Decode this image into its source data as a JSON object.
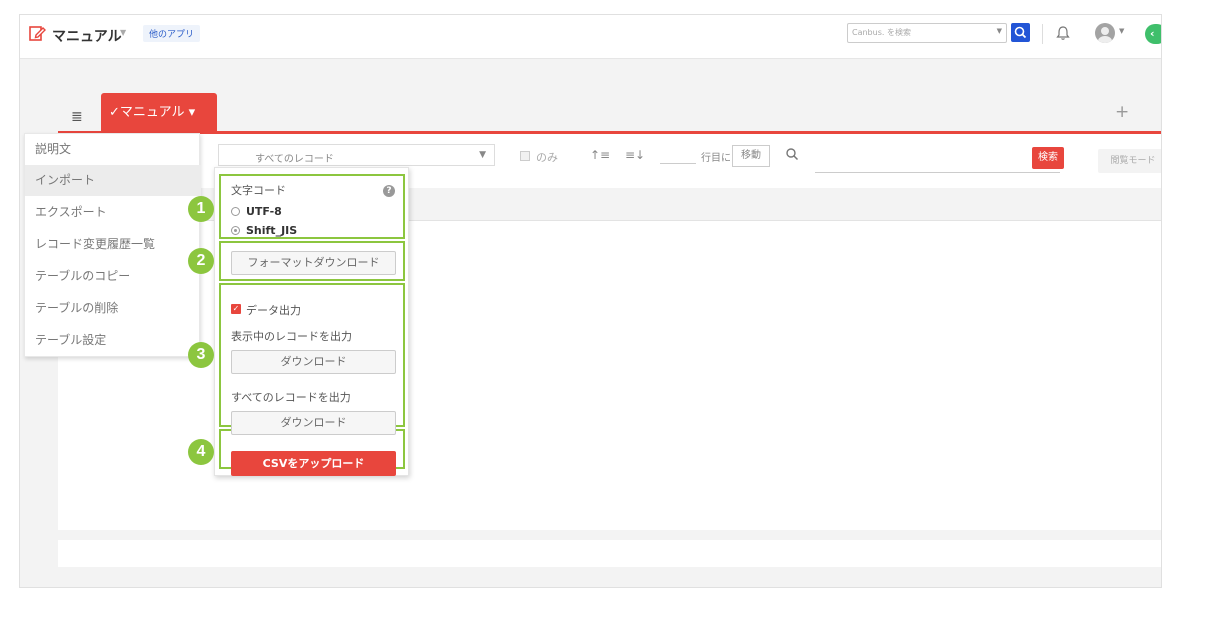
{
  "header": {
    "app_title": "マニュアル",
    "other_apps": "他のアプリ",
    "search_placeholder": "Canbus. を検索"
  },
  "tabs": {
    "active_label": "✓マニュアル ▾",
    "add": "+"
  },
  "toolbar": {
    "view_select": "すべてのレコード",
    "only_label": "のみ",
    "row_label": "行目に",
    "move_button": "移動",
    "search_button": "検索",
    "browse_mode": "閲覧モード"
  },
  "side_menu": {
    "items": [
      {
        "label": "説明文"
      },
      {
        "label": "インポート"
      },
      {
        "label": "エクスポート"
      },
      {
        "label": "レコード変更履歴一覧"
      },
      {
        "label": "テーブルのコピー"
      },
      {
        "label": "テーブルの削除"
      },
      {
        "label": "テーブル設定"
      }
    ],
    "highlighted_index": 1
  },
  "import_export": {
    "charcode_title": "文字コード",
    "options": [
      "UTF-8",
      "Shift_JIS"
    ],
    "selected_option": "Shift_JIS",
    "format_download": "フォーマットダウンロード",
    "data_output": "データ出力",
    "data_output_checked": true,
    "displayed_records_label": "表示中のレコードを出力",
    "download_label": "ダウンロード",
    "all_records_label": "すべてのレコードを出力",
    "csv_upload": "CSVをアップロード"
  },
  "badges": [
    "1",
    "2",
    "3",
    "4"
  ],
  "colors": {
    "accent_red": "#e8463d",
    "annotation_green": "#8cc63f",
    "search_blue": "#2255d6",
    "status_green": "#3fbf6b"
  },
  "icons": {
    "app": "edit-document-icon",
    "search": "search-icon",
    "bell": "bell-icon",
    "avatar": "user-avatar-icon",
    "menu": "hamburger-icon",
    "sort_asc": "sort-ascending-icon",
    "sort_desc": "sort-descending-icon",
    "help": "help-icon"
  }
}
